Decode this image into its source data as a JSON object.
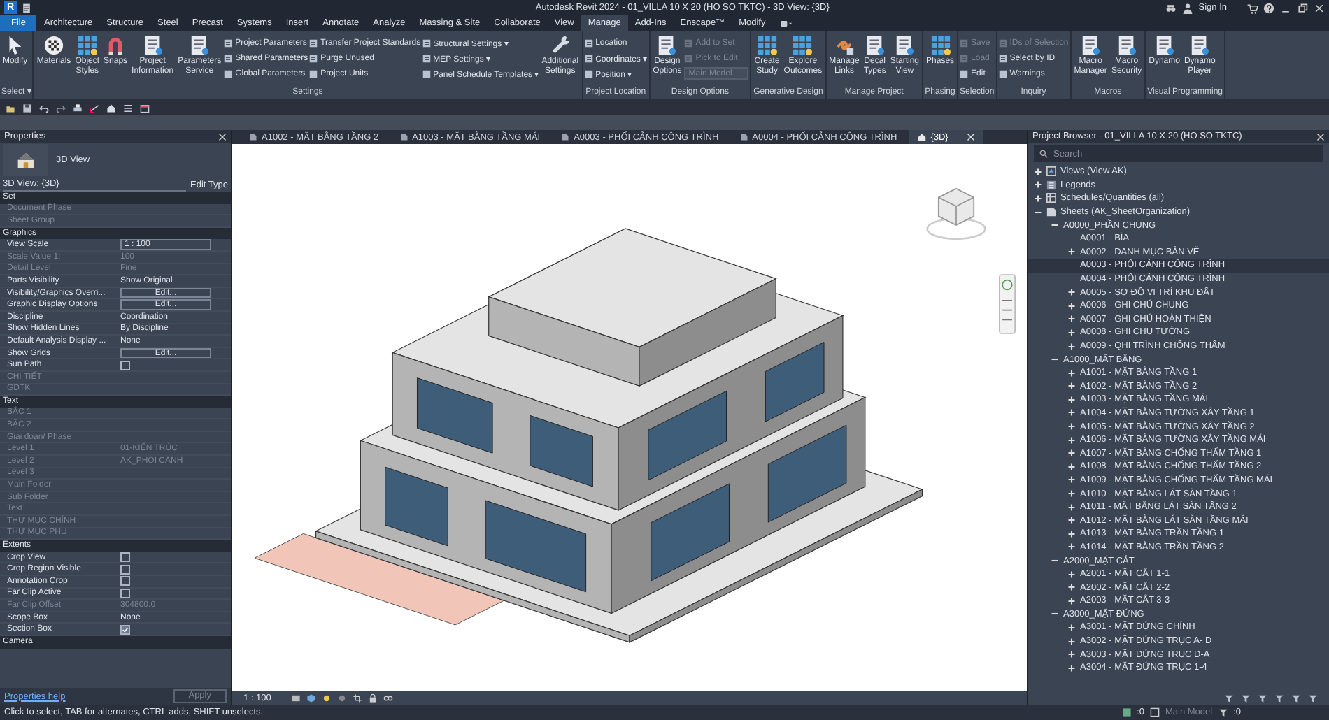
{
  "window": {
    "logo": "R",
    "title": "Autodesk Revit 2024 - 01_VILLA 10 X 20 (HO SO TKTC) - 3D View: {3D}",
    "sign_in": "Sign In"
  },
  "ribbon_tabs": [
    {
      "label": "File",
      "kind": "file",
      "selected": false
    },
    {
      "label": "Architecture",
      "kind": "tab",
      "selected": false
    },
    {
      "label": "Structure",
      "kind": "tab",
      "selected": false
    },
    {
      "label": "Steel",
      "kind": "tab",
      "selected": false
    },
    {
      "label": "Precast",
      "kind": "tab",
      "selected": false
    },
    {
      "label": "Systems",
      "kind": "tab",
      "selected": false
    },
    {
      "label": "Insert",
      "kind": "tab",
      "selected": false
    },
    {
      "label": "Annotate",
      "kind": "tab",
      "selected": false
    },
    {
      "label": "Analyze",
      "kind": "tab",
      "selected": false
    },
    {
      "label": "Massing & Site",
      "kind": "tab",
      "selected": false
    },
    {
      "label": "Collaborate",
      "kind": "tab",
      "selected": false
    },
    {
      "label": "View",
      "kind": "tab",
      "selected": false
    },
    {
      "label": "Manage",
      "kind": "tab",
      "selected": true
    },
    {
      "label": "Add-Ins",
      "kind": "tab",
      "selected": false
    },
    {
      "label": "Enscape™",
      "kind": "tab",
      "selected": false
    },
    {
      "label": "Modify",
      "kind": "tab",
      "selected": false
    }
  ],
  "ribbon_panels": [
    {
      "label": "Select ▾",
      "groups": [
        {
          "kind": "large",
          "items": [
            {
              "label": "Modify"
            }
          ]
        }
      ]
    },
    {
      "label": "Settings",
      "groups": [
        {
          "kind": "large",
          "items": [
            {
              "label": "Materials"
            },
            {
              "label": "Object Styles"
            },
            {
              "label": "Snaps"
            },
            {
              "label": "Project Information"
            },
            {
              "label": "Parameters Service"
            }
          ]
        },
        {
          "kind": "stack",
          "items": [
            {
              "kind": "tool",
              "label": "Project Parameters",
              "disabled": false
            },
            {
              "kind": "tool",
              "label": "Shared Parameters",
              "disabled": false
            },
            {
              "kind": "tool",
              "label": "Global Parameters",
              "disabled": false
            }
          ]
        },
        {
          "kind": "stack",
          "items": [
            {
              "kind": "tool",
              "label": "Transfer Project Standards",
              "disabled": false
            },
            {
              "kind": "tool",
              "label": "Purge Unused",
              "disabled": false
            },
            {
              "kind": "tool",
              "label": "Project Units",
              "disabled": false
            }
          ]
        },
        {
          "kind": "stack",
          "items": [
            {
              "kind": "tool",
              "label": "Structural Settings ▾",
              "disabled": false
            },
            {
              "kind": "tool",
              "label": "MEP Settings ▾",
              "disabled": false
            },
            {
              "kind": "tool",
              "label": "Panel Schedule Templates ▾",
              "disabled": false
            }
          ]
        },
        {
          "kind": "large",
          "items": [
            {
              "label": "Additional Settings"
            }
          ]
        }
      ]
    },
    {
      "label": "Project Location",
      "groups": [
        {
          "kind": "stack",
          "items": [
            {
              "kind": "tool",
              "label": "Location",
              "disabled": false
            },
            {
              "kind": "tool",
              "label": "Coordinates ▾",
              "disabled": false
            },
            {
              "kind": "tool",
              "label": "Position ▾",
              "disabled": false
            }
          ]
        }
      ]
    },
    {
      "label": "Design Options",
      "groups": [
        {
          "kind": "large",
          "items": [
            {
              "label": "Design Options"
            }
          ]
        },
        {
          "kind": "stack",
          "items": [
            {
              "kind": "tool",
              "label": "Add to Set",
              "disabled": true
            },
            {
              "kind": "tool",
              "label": "Pick to Edit",
              "disabled": true
            },
            {
              "kind": "combo",
              "label": "Main Model",
              "disabled": true
            }
          ]
        }
      ]
    },
    {
      "label": "Generative Design",
      "groups": [
        {
          "kind": "large",
          "items": [
            {
              "label": "Create Study"
            },
            {
              "label": "Explore Outcomes"
            }
          ]
        }
      ]
    },
    {
      "label": "Manage Project",
      "groups": [
        {
          "kind": "large",
          "items": [
            {
              "label": "Manage Links"
            },
            {
              "label": "Decal Types"
            },
            {
              "label": "Starting View"
            }
          ]
        }
      ]
    },
    {
      "label": "Phasing",
      "groups": [
        {
          "kind": "large",
          "items": [
            {
              "label": "Phases"
            }
          ]
        }
      ]
    },
    {
      "label": "Selection",
      "groups": [
        {
          "kind": "stack",
          "items": [
            {
              "kind": "tool",
              "label": "Save",
              "disabled": true
            },
            {
              "kind": "tool",
              "label": "Load",
              "disabled": true
            },
            {
              "kind": "tool",
              "label": "Edit",
              "disabled": false
            }
          ]
        }
      ]
    },
    {
      "label": "Inquiry",
      "groups": [
        {
          "kind": "stack",
          "items": [
            {
              "kind": "tool",
              "label": "IDs of Selection",
              "disabled": true
            },
            {
              "kind": "tool",
              "label": "Select by ID",
              "disabled": false
            },
            {
              "kind": "tool",
              "label": "Warnings",
              "disabled": false
            }
          ]
        }
      ]
    },
    {
      "label": "Macros",
      "groups": [
        {
          "kind": "large",
          "items": [
            {
              "label": "Macro Manager"
            },
            {
              "label": "Macro Security"
            }
          ]
        }
      ]
    },
    {
      "label": "Visual Programming",
      "groups": [
        {
          "kind": "large",
          "items": [
            {
              "label": "Dynamo"
            },
            {
              "label": "Dynamo Player"
            }
          ]
        }
      ]
    }
  ],
  "properties": {
    "title": "Properties",
    "type_name": "3D View",
    "view_selector": "3D View: {3D}",
    "edit_type": "Edit Type",
    "sections": [
      {
        "name": "Set",
        "rows": [
          {
            "name": "Document Phase",
            "kind": "text",
            "disabled": true
          },
          {
            "name": "Sheet Group",
            "kind": "text",
            "disabled": true
          }
        ]
      },
      {
        "name": "Graphics",
        "rows": [
          {
            "name": "View Scale",
            "value": "1 : 100",
            "kind": "input",
            "disabled": false
          },
          {
            "name": "Scale Value 1:",
            "value": "100",
            "kind": "text",
            "disabled": true
          },
          {
            "name": "Detail Level",
            "value": "Fine",
            "kind": "text",
            "disabled": true
          },
          {
            "name": "Parts Visibility",
            "value": "Show Original",
            "kind": "text",
            "disabled": false
          },
          {
            "name": "Visibility/Graphics Overri...",
            "value": "Edit...",
            "kind": "button",
            "disabled": false
          },
          {
            "name": "Graphic Display Options",
            "value": "Edit...",
            "kind": "button",
            "disabled": false
          },
          {
            "name": "Discipline",
            "value": "Coordination",
            "kind": "text",
            "disabled": false
          },
          {
            "name": "Show Hidden Lines",
            "value": "By Discipline",
            "kind": "text",
            "disabled": false
          },
          {
            "name": "Default Analysis Display ...",
            "value": "None",
            "kind": "text",
            "disabled": false
          },
          {
            "name": "Show Grids",
            "value": "Edit...",
            "kind": "button",
            "disabled": false
          },
          {
            "name": "Sun Path",
            "kind": "checkbox",
            "checked": false,
            "disabled": false
          },
          {
            "name": "CHI TIẾT",
            "kind": "text",
            "disabled": true
          },
          {
            "name": "GDTK",
            "kind": "text",
            "disabled": true
          }
        ]
      },
      {
        "name": "Text",
        "rows": [
          {
            "name": "BẬC 1",
            "kind": "text",
            "disabled": true
          },
          {
            "name": "BẬC 2",
            "kind": "text",
            "disabled": true
          },
          {
            "name": "Giai đoạn/ Phase",
            "kind": "text",
            "disabled": true
          },
          {
            "name": "Level 1",
            "value": "01-KIẾN TRÚC",
            "kind": "text",
            "disabled": true
          },
          {
            "name": "Level 2",
            "value": "AK_PHOI CANH",
            "kind": "text",
            "disabled": true
          },
          {
            "name": "Level 3",
            "kind": "text",
            "disabled": true
          },
          {
            "name": "Main Folder",
            "kind": "text",
            "disabled": true
          },
          {
            "name": "Sub Folder",
            "kind": "text",
            "disabled": true
          },
          {
            "name": "Text",
            "kind": "text",
            "disabled": true
          },
          {
            "name": "THƯ MỤC CHÍNH",
            "kind": "text",
            "disabled": true
          },
          {
            "name": "THƯ MỤC PHỤ",
            "kind": "text",
            "disabled": true
          }
        ]
      },
      {
        "name": "Extents",
        "rows": [
          {
            "name": "Crop View",
            "kind": "checkbox",
            "checked": false,
            "disabled": false
          },
          {
            "name": "Crop Region Visible",
            "kind": "checkbox",
            "checked": false,
            "disabled": false
          },
          {
            "name": "Annotation Crop",
            "kind": "checkbox",
            "checked": false,
            "disabled": false
          },
          {
            "name": "Far Clip Active",
            "kind": "checkbox",
            "checked": false,
            "disabled": false
          },
          {
            "name": "Far Clip Offset",
            "value": "304800.0",
            "kind": "text",
            "disabled": true
          },
          {
            "name": "Scope Box",
            "value": "None",
            "kind": "text",
            "disabled": false
          },
          {
            "name": "Section Box",
            "kind": "checkbox",
            "checked": true,
            "disabled": false
          }
        ]
      },
      {
        "name": "Camera"
      }
    ],
    "help_link": "Properties help",
    "apply": "Apply"
  },
  "view_tabs": [
    {
      "label": "A1002 - MẶT BẰNG TẦNG 2",
      "kind": "sheet",
      "selected": false
    },
    {
      "label": "A1003 - MẶT BẰNG TẦNG MÁI",
      "kind": "sheet",
      "selected": false
    },
    {
      "label": "A0003 - PHỐI CẢNH CÔNG TRÌNH",
      "kind": "sheet",
      "selected": false
    },
    {
      "label": "A0004 - PHỐI CẢNH CÔNG TRÌNH",
      "kind": "sheet",
      "selected": false
    },
    {
      "label": "{3D}",
      "kind": "model",
      "selected": true
    }
  ],
  "view_control_bar": {
    "scale": "1 : 100"
  },
  "browser": {
    "title": "Project Browser - 01_VILLA 10 X 20 (HO SO TKTC)",
    "search": {
      "placeholder": "Search"
    },
    "tree": [
      {
        "label": "Views (View AK)",
        "kind": "views",
        "expanded": false,
        "selected": false
      },
      {
        "label": "Legends",
        "kind": "legends",
        "expanded": false,
        "selected": false
      },
      {
        "label": "Schedules/Quantities (all)",
        "kind": "schedules",
        "expanded": false,
        "selected": false
      },
      {
        "label": "Sheets (AK_SheetOrganization)",
        "kind": "sheets",
        "expanded": true,
        "selected": false,
        "children": [
          {
            "label": "A0000_PHẦN CHUNG",
            "expanded": true,
            "selected": false,
            "children": [
              {
                "label": "A0001 - BÌA",
                "selected": false
              },
              {
                "label": "A0002 - DANH MỤC BẢN VẼ",
                "expanded": false,
                "selected": false
              },
              {
                "label": "A0003 - PHỐI CẢNH CÔNG TRÌNH",
                "selected": true
              },
              {
                "label": "A0004 - PHỐI CẢNH CÔNG TRÌNH",
                "selected": false
              },
              {
                "label": "A0005 - SƠ ĐỒ VỊ TRÍ KHU ĐẤT",
                "expanded": false,
                "selected": false
              },
              {
                "label": "A0006 - GHI CHÚ CHUNG",
                "expanded": false,
                "selected": false
              },
              {
                "label": "A0007 - GHI CHÚ HOÀN THIỆN",
                "expanded": false,
                "selected": false
              },
              {
                "label": "A0008 - GHI CHU TƯỜNG",
                "expanded": false,
                "selected": false
              },
              {
                "label": "A0009 - QHI TRÌNH CHỐNG THẤM",
                "expanded": false,
                "selected": false
              }
            ]
          },
          {
            "label": "A1000_MẶT BẰNG",
            "expanded": true,
            "selected": false,
            "children": [
              {
                "label": "A1001 - MẶT BẰNG TẦNG 1",
                "expanded": false,
                "selected": false
              },
              {
                "label": "A1002 - MẶT BẰNG TẦNG 2",
                "expanded": false,
                "selected": false
              },
              {
                "label": "A1003 - MẶT BẰNG TẦNG MÁI",
                "expanded": false,
                "selected": false
              },
              {
                "label": "A1004 - MẶT BẰNG TƯỜNG XÂY TẦNG 1",
                "expanded": false,
                "selected": false
              },
              {
                "label": "A1005 - MẶT BẰNG TƯỜNG XÂY TẦNG 2",
                "expanded": false,
                "selected": false
              },
              {
                "label": "A1006 - MẶT BẰNG TƯỜNG XÂY TẦNG MÁI",
                "expanded": false,
                "selected": false
              },
              {
                "label": "A1007 - MẶT BẰNG CHỐNG THẤM TẦNG 1",
                "expanded": false,
                "selected": false
              },
              {
                "label": "A1008 - MẶT BẰNG CHỐNG THẤM TẦNG 2",
                "expanded": false,
                "selected": false
              },
              {
                "label": "A1009 - MẶT BẰNG CHỐNG THẤM TẦNG MÁI",
                "expanded": false,
                "selected": false
              },
              {
                "label": "A1010 - MẶT BẰNG LÁT SÀN TẦNG 1",
                "expanded": false,
                "selected": false
              },
              {
                "label": "A1011 - MẶT BẰNG LÁT SÀN TẦNG 2",
                "expanded": false,
                "selected": false
              },
              {
                "label": "A1012 - MẶT BẰNG LÁT SÀN TẦNG MÁI",
                "expanded": false,
                "selected": false
              },
              {
                "label": "A1013 - MẶT BẰNG TRẦN TẦNG 1",
                "expanded": false,
                "selected": false
              },
              {
                "label": "A1014 - MẶT BẰNG TRẦN TẦNG 2",
                "expanded": false,
                "selected": false
              }
            ]
          },
          {
            "label": "A2000_MẶT CẮT",
            "expanded": true,
            "selected": false,
            "children": [
              {
                "label": "A2001 - MẶT CẮT 1-1",
                "expanded": false,
                "selected": false
              },
              {
                "label": "A2002 - MẶT CẮT 2-2",
                "expanded": false,
                "selected": false
              },
              {
                "label": "A2003 - MẶT CẮT 3-3",
                "expanded": false,
                "selected": false
              }
            ]
          },
          {
            "label": "A3000_MẶT ĐỨNG",
            "expanded": true,
            "selected": false,
            "children": [
              {
                "label": "A3001 - MẶT ĐỨNG CHÍNH",
                "expanded": false,
                "selected": false
              },
              {
                "label": "A3002 - MẶT ĐỨNG TRỤC A- D",
                "expanded": false,
                "selected": false
              },
              {
                "label": "A3003 - MẶT ĐỨNG TRỤC D-A",
                "expanded": false,
                "selected": false
              },
              {
                "label": "A3004 - MẶT ĐỨNG TRỤC 1-4",
                "expanded": false,
                "selected": false
              }
            ]
          }
        ]
      }
    ]
  },
  "status_bar": {
    "message": "Click to select, TAB for alternates, CTRL adds, SHIFT unselects.",
    "workset_count": ":0",
    "model": "Main Model",
    "filter_count": ":0"
  }
}
